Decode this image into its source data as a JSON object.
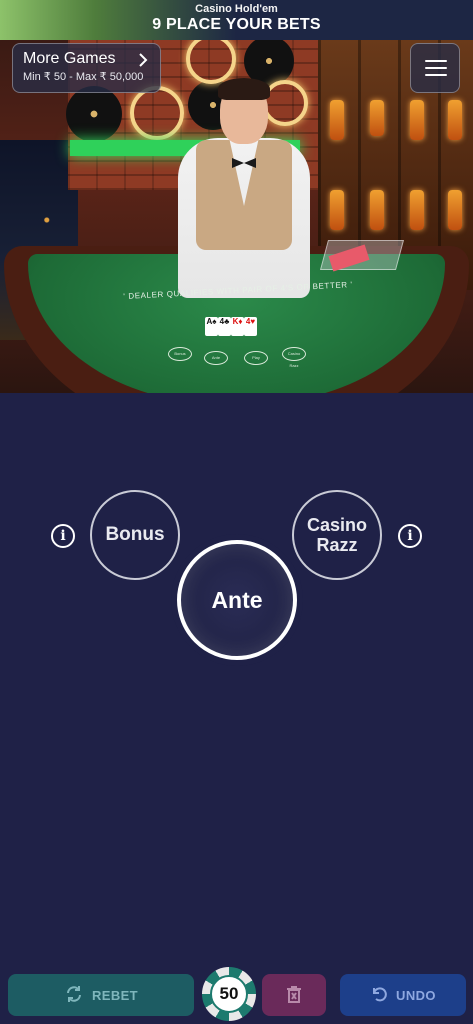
{
  "header": {
    "game_title": "Casino Hold'em",
    "status": "9 PLACE YOUR BETS"
  },
  "lobby": {
    "more_games_label": "More Games",
    "limits": "Min ₹ 50 - Max ₹ 50,000",
    "chevron_icon": "chevron-right-icon",
    "menu_icon": "hamburger-menu-icon"
  },
  "table_video": {
    "felt_text": "' DEALER QUALIFIES WITH PAIR OF 4'S OR BETTER '",
    "community_cards": [
      "A♠",
      "4♣",
      "K♦",
      "4♥"
    ],
    "felt_spots": [
      "Bonus",
      "Ante",
      "Play",
      "Casino Razz"
    ]
  },
  "bets": {
    "bonus_label": "Bonus",
    "ante_label": "Ante",
    "razz_label": "Casino Razz",
    "info_icon": "info-icon"
  },
  "controls": {
    "rebet_label": "REBET",
    "undo_label": "UNDO",
    "chip_value": "50",
    "delete_icon": "trash-icon"
  },
  "colors": {
    "background": "#1f2147",
    "rebet": "#1d5c63",
    "delete": "#6a2a5a",
    "undo": "#1d3f8a",
    "chip_accent": "#1d7a6e"
  }
}
